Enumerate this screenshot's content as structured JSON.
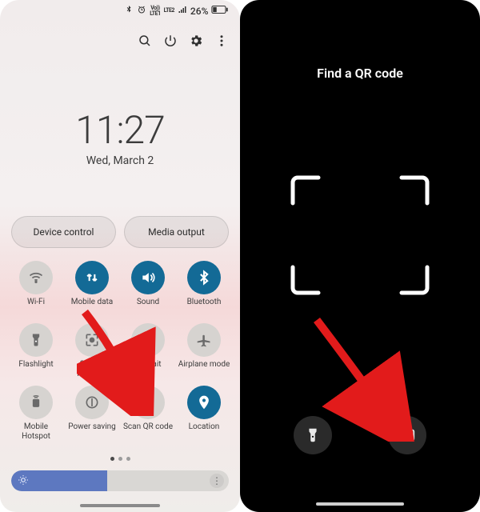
{
  "status": {
    "volte1": "Vo))",
    "volte2": "LTE1",
    "lte": "LTE2",
    "signal": "signal",
    "battery_pct": "26%"
  },
  "clock": {
    "time": "11:27",
    "date": "Wed, March 2"
  },
  "pills": {
    "device_control": "Device control",
    "media_output": "Media output"
  },
  "tiles": [
    {
      "label": "Wi-Fi",
      "state": "off",
      "icon": "wifi"
    },
    {
      "label": "Mobile data",
      "state": "on",
      "icon": "updown"
    },
    {
      "label": "Sound",
      "state": "on",
      "icon": "sound"
    },
    {
      "label": "Bluetooth",
      "state": "on",
      "icon": "bluetooth"
    },
    {
      "label": "Flashlight",
      "state": "off",
      "icon": "flashlight"
    },
    {
      "label": "Screen recorder",
      "state": "off",
      "icon": "record"
    },
    {
      "label": "Portrait",
      "state": "off",
      "icon": "portrait"
    },
    {
      "label": "Airplane mode",
      "state": "off",
      "icon": "airplane"
    },
    {
      "label": "Mobile Hotspot",
      "state": "off",
      "icon": "hotspot"
    },
    {
      "label": "Power saving",
      "state": "off",
      "icon": "powersave"
    },
    {
      "label": "Scan QR code",
      "state": "off",
      "icon": "qr"
    },
    {
      "label": "Location",
      "state": "on",
      "icon": "location"
    }
  ],
  "brightness": {
    "percent": 44
  },
  "qr": {
    "title": "Find a QR code"
  }
}
